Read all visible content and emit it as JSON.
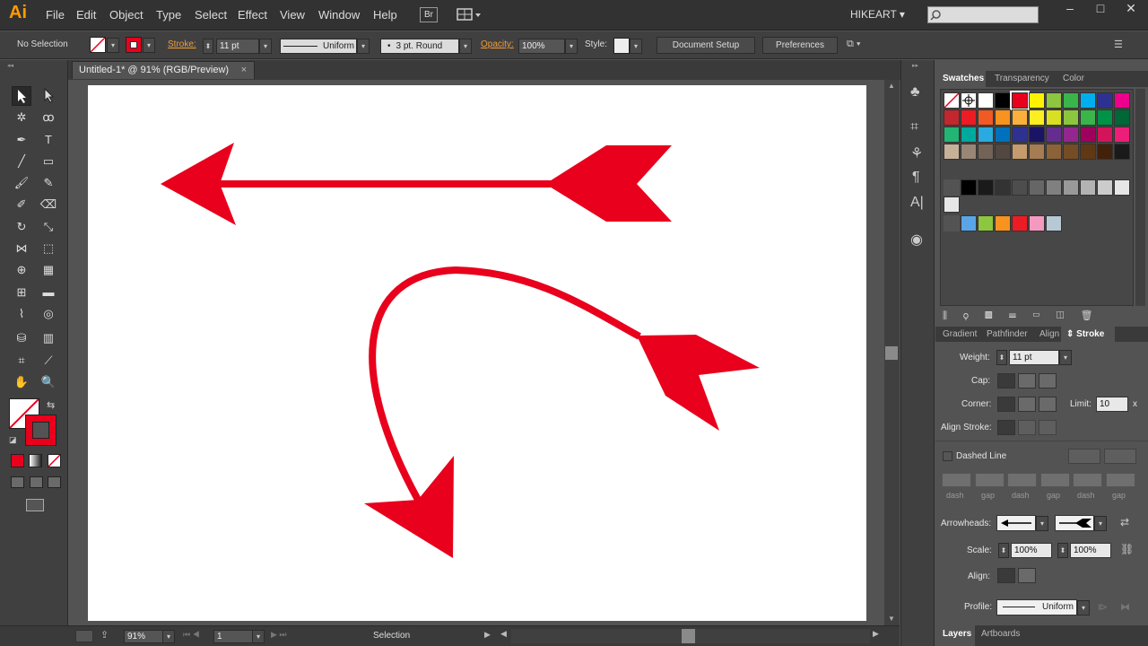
{
  "app": {
    "logo": "Ai",
    "workspace": "HIKEART",
    "bridge_label": "Br"
  },
  "menu": [
    "File",
    "Edit",
    "Object",
    "Type",
    "Select",
    "Effect",
    "View",
    "Window",
    "Help"
  ],
  "window_controls": [
    "–",
    "□",
    "✕"
  ],
  "control_bar": {
    "selection": "No Selection",
    "stroke_label": "Stroke:",
    "stroke_weight": "11 pt",
    "profile": "Uniform",
    "brush": "3 pt. Round",
    "opacity_label": "Opacity:",
    "opacity": "100%",
    "style_label": "Style:",
    "document_setup": "Document Setup",
    "preferences": "Preferences"
  },
  "document_tab": {
    "title": "Untitled-1* @ 91% (RGB/Preview)",
    "close": "×"
  },
  "status_bar": {
    "zoom": "91%",
    "artboard": "1",
    "tool": "Selection"
  },
  "swatches_panel": {
    "tabs": [
      "Swatches",
      "Transparency",
      "Color"
    ],
    "rows": [
      [
        "#ffffff",
        "#ffffff",
        "#ffffff",
        "#000000",
        "#e8001c",
        "#fff200",
        "#8dc63f",
        "#39b54a",
        "#00aeef",
        "#2e3192",
        "#ec008c"
      ],
      [
        "#c1272d",
        "#ed1c24",
        "#f15a24",
        "#f7931e",
        "#fbb03b",
        "#fcee21",
        "#d9e021",
        "#8cc63f",
        "#39b54a",
        "#009245",
        "#006837"
      ],
      [
        "#22b573",
        "#00a99d",
        "#29abe2",
        "#0071bc",
        "#2e3192",
        "#1b1464",
        "#662d91",
        "#93278f",
        "#9e005d",
        "#d4145a",
        "#ed1e79"
      ],
      [
        "#c7b299",
        "#998675",
        "#736357",
        "#534741",
        "#c69c6d",
        "#a67c52",
        "#8c6239",
        "#754c24",
        "#603813",
        "#42210b",
        "#1a1a1a"
      ]
    ],
    "grays": [
      "#000000",
      "#1a1a1a",
      "#333333",
      "#4d4d4d",
      "#666666",
      "#808080",
      "#999999",
      "#b3b3b3",
      "#cccccc",
      "#e6e6e6"
    ],
    "group2": [
      "#5aa5e8",
      "#8dc63f",
      "#f7931e",
      "#ed1c24",
      "#f49ac1",
      "#b8c9d6"
    ]
  },
  "stroke_panel": {
    "tabs": [
      "Gradient",
      "Pathfinder",
      "Align",
      "Stroke"
    ],
    "weight_label": "Weight:",
    "weight": "11 pt",
    "cap_label": "Cap:",
    "corner_label": "Corner:",
    "limit_label": "Limit:",
    "limit": "10",
    "limit_unit": "x",
    "align_label": "Align Stroke:",
    "dashed_label": "Dashed Line",
    "dash_labels": [
      "dash",
      "gap",
      "dash",
      "gap",
      "dash",
      "gap"
    ],
    "arrowheads_label": "Arrowheads:",
    "scale_label": "Scale:",
    "scale_start": "100%",
    "scale_end": "100%",
    "align2_label": "Align:",
    "profile_label": "Profile:",
    "profile": "Uniform"
  },
  "layers_panel": {
    "tabs": [
      "Layers",
      "Artboards"
    ]
  },
  "colors": {
    "arrow_red": "#e8001c",
    "accent_orange": "#f29d38"
  }
}
